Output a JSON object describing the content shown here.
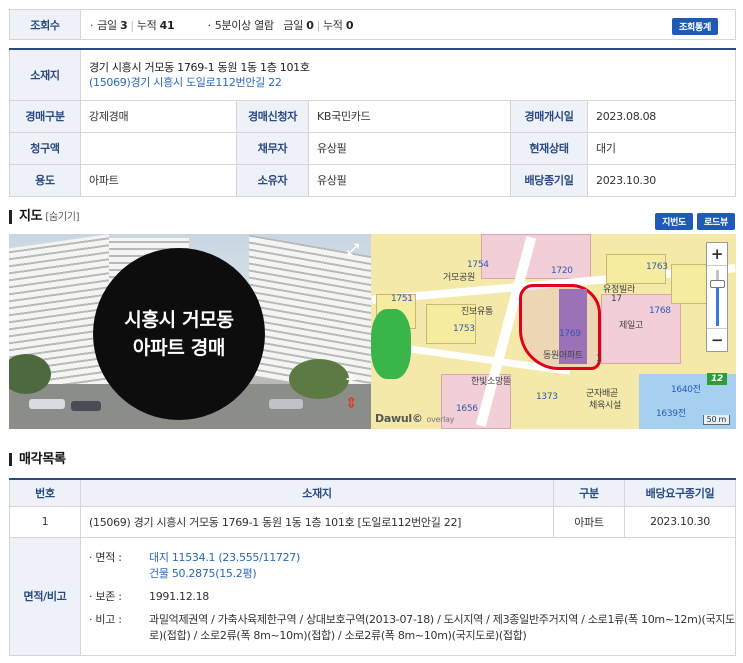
{
  "views": {
    "label": "조회수",
    "today_label": "금일",
    "today_value": "3",
    "total_label": "누적",
    "total_value": "41",
    "long_label": "5분이상 열람",
    "long_today_label": "금일",
    "long_today_value": "0",
    "long_total_label": "누적",
    "long_total_value": "0",
    "stats_button": "조회통계"
  },
  "info": {
    "location_label": "소재지",
    "address_line1": "경기 시흥시 거모동 1769-1 동원 1동 1층 101호",
    "address_line2": "(15069)경기 시흥시  도일로112번안길 22",
    "auction_type_label": "경매구분",
    "auction_type": "강제경매",
    "applicant_label": "경매신청자",
    "applicant": "KB국민카드",
    "start_label": "경매개시일",
    "start_date": "2023.08.08",
    "claim_label": "청구액",
    "claim": "",
    "debtor_label": "채무자",
    "debtor": "유상필",
    "status_label": "현재상태",
    "status": "대기",
    "use_label": "용도",
    "use": "아파트",
    "owner_label": "소유자",
    "owner": "유상필",
    "deadline_label": "배당종기일",
    "deadline": "2023.10.30"
  },
  "map": {
    "title": "지도",
    "toggle": "[숨기기]",
    "btn_map": "지번도",
    "btn_road": "로드뷰",
    "roadview_line1": "시흥시 거모동",
    "roadview_line2": "아파트 경매",
    "zoom_in": "+",
    "zoom_out": "−",
    "zoom_level": "12",
    "provider": "Dawul©",
    "overlay": "overlay",
    "scale": "50 m",
    "parcels": [
      "1754",
      "1720",
      "1751",
      "1753",
      "1769",
      "1640전",
      "1639전",
      "1763",
      "1768",
      "1656",
      "1373",
      "17",
      "1"
    ],
    "places": [
      "거모공원",
      "진보유통",
      "유정빌라",
      "동원아파트",
      "군자배곧",
      "제일고",
      "체육시설",
      "한빛소망뜰"
    ]
  },
  "list": {
    "title": "매각목록",
    "col_no": "번호",
    "col_location": "소재지",
    "col_type": "구분",
    "col_deadline": "배당요구종기일",
    "row_no": "1",
    "row_location": "(15069) 경기 시흥시 거모동 1769-1 동원 1동 1층 101호 [도일로112번안길 22]",
    "row_type": "아파트",
    "row_deadline": "2023.10.30",
    "area_label": "면적/비고",
    "area_key": "· 면적 :",
    "area_land": "대지 11534.1 (23.555/11727)",
    "area_building": "건물 50.2875(15.2평)",
    "preserve_key": "· 보존 :",
    "preserve_value": "1991.12.18",
    "note_key": "· 비고 :",
    "note_value": "과밀억제권역 / 가축사육제한구역 / 상대보호구역(2013-07-18) / 도시지역 / 제3종일반주거지역 / 소로1류(폭 10m~12m)(국지도로)(접합) / 소로2류(폭 8m~10m)(접합) / 소로2류(폭 8m~10m)(국지도로)(접합)"
  }
}
